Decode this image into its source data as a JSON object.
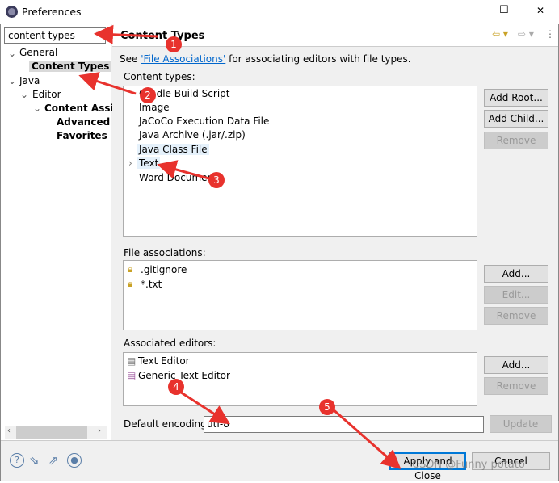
{
  "window": {
    "title": "Preferences",
    "minimize": "—",
    "maximize": "☐",
    "close": "✕"
  },
  "sidebar": {
    "search_value": "content types",
    "tree": [
      {
        "label": "General",
        "expanded": true
      },
      {
        "label": "Content Types",
        "selected": true
      },
      {
        "label": "Java",
        "expanded": true
      },
      {
        "label": "Editor",
        "expanded": true
      },
      {
        "label": "Content Assis",
        "expanded": true
      },
      {
        "label": "Advanced"
      },
      {
        "label": "Favorites"
      }
    ]
  },
  "page": {
    "title": "Content Types",
    "see_prefix": "See ",
    "see_link": "'File Associations'",
    "see_suffix": " for associating editors with file types.",
    "content_types_label": "Content types:",
    "content_types": [
      "Gradle Build Script",
      "Image",
      "JaCoCo Execution Data File",
      "Java Archive (.jar/.zip)",
      "Java Class File",
      "Text",
      "Word Document"
    ],
    "ct_buttons": [
      "Add Root...",
      "Add Child...",
      "Remove"
    ],
    "file_assoc_label": "File associations:",
    "file_assoc": [
      ".gitignore",
      "*.txt"
    ],
    "fa_buttons": [
      "Add...",
      "Edit...",
      "Remove"
    ],
    "editors_label": "Associated editors:",
    "editors": [
      "Text Editor",
      "Generic Text Editor"
    ],
    "ed_buttons": [
      "Add...",
      "Remove"
    ],
    "encoding_label": "Default encoding:",
    "encoding_value": "utf-8",
    "update": "Update"
  },
  "footer": {
    "apply_close": "Apply and Close",
    "cancel": "Cancel"
  },
  "annotations": [
    "1",
    "2",
    "3",
    "4",
    "5"
  ],
  "watermark": "CSDN @Funny potato",
  "colors": {
    "annotation": "#e8322d",
    "selection": "#e5f1fb",
    "link": "#0066cc"
  }
}
